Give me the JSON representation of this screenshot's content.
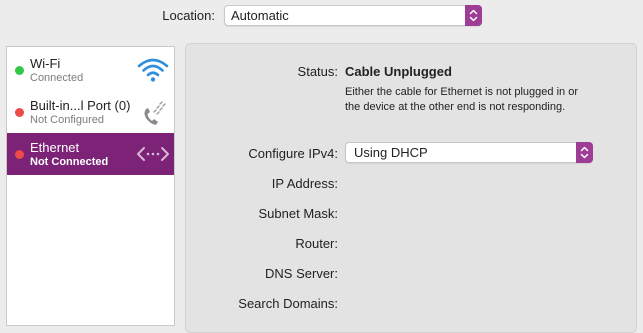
{
  "location": {
    "label": "Location:",
    "value": "Automatic"
  },
  "services": [
    {
      "name": "Wi-Fi",
      "status": "Connected",
      "status_color": "#34c749",
      "icon": "wifi-icon"
    },
    {
      "name": "Built-in...l Port (0)",
      "status": "Not Configured",
      "status_color": "#ee4a4a",
      "icon": "phone-icon"
    },
    {
      "name": "Ethernet",
      "status": "Not Connected",
      "status_color": "#ee4a4a",
      "icon": "ethernet-icon",
      "selected": true
    }
  ],
  "detail": {
    "status_label": "Status:",
    "status_value": "Cable Unplugged",
    "status_description": "Either the cable for Ethernet is not plugged in or the device at the other end is not responding.",
    "configure_label": "Configure IPv4:",
    "configure_value": "Using DHCP",
    "ip_label": "IP Address:",
    "subnet_label": "Subnet Mask:",
    "router_label": "Router:",
    "dns_label": "DNS Server:",
    "search_label": "Search Domains:"
  },
  "colors": {
    "accent": "#9d3d96",
    "selection": "#7c2377",
    "wifi_icon": "#2f8fdc"
  }
}
